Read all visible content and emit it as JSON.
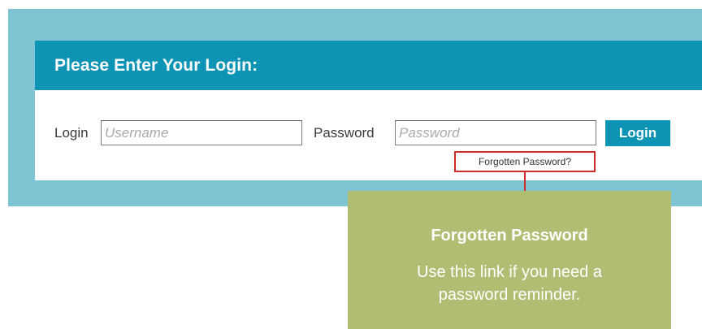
{
  "header": {
    "title": "Please Enter Your Login:"
  },
  "form": {
    "login_label": "Login",
    "username_placeholder": "Username",
    "username_value": "",
    "password_label": "Password",
    "password_placeholder": "Password",
    "password_value": "",
    "login_button_label": "Login",
    "forgot_link_label": "Forgotten Password?"
  },
  "callout": {
    "title": "Forgotten Password",
    "text": "Use this link if you need a password reminder."
  },
  "colors": {
    "band": "#7ec4d2",
    "accent": "#0d93b4",
    "highlight_border": "#d02b2b",
    "callout_bg": "#afbe72"
  }
}
